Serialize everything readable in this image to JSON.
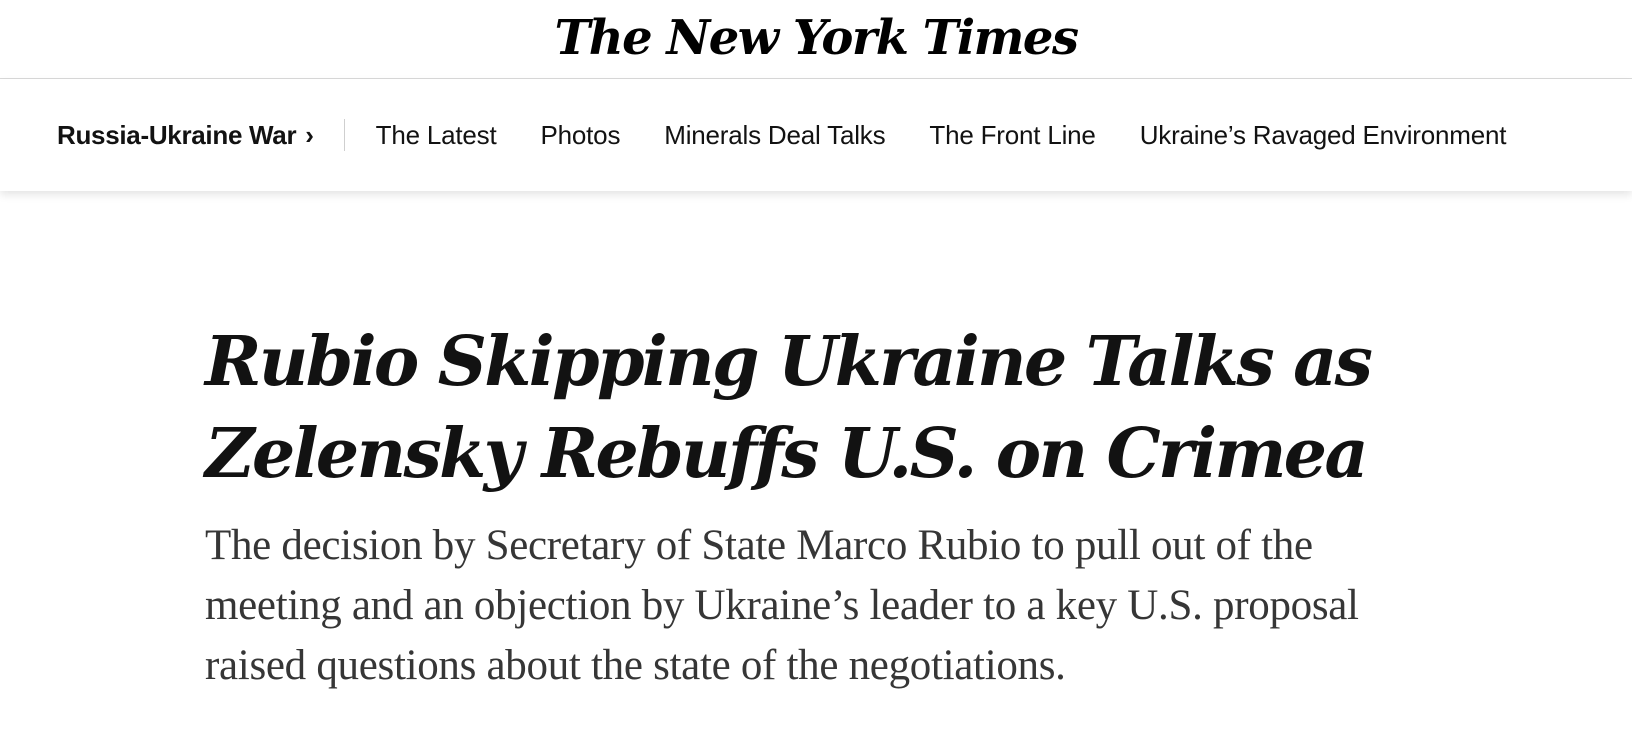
{
  "masthead": {
    "logo_text": "The New York Times"
  },
  "section_nav": {
    "section_title": "Russia-Ukraine War",
    "chevron": "›",
    "links": [
      {
        "label": "The Latest"
      },
      {
        "label": "Photos"
      },
      {
        "label": "Minerals Deal Talks"
      },
      {
        "label": "The Front Line"
      },
      {
        "label": "Ukraine’s Ravaged Environment"
      }
    ]
  },
  "article": {
    "headline_line1": "Rubio Skipping Ukraine Talks as",
    "headline_line2": "Zelensky Rebuffs U.S. on Crimea",
    "summary": "The decision by Secretary of State Marco Rubio to pull out of the meeting and an objection by Ukraine’s leader to a key U.S. proposal raised questions about the state of the negotiations."
  },
  "colors": {
    "text": "#121212",
    "summary_text": "#363636",
    "divider": "#d9d9d9",
    "background": "#ffffff"
  }
}
